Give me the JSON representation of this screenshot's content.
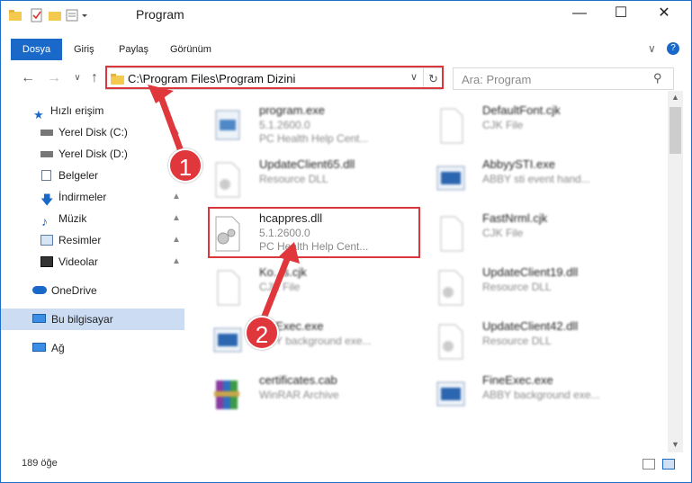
{
  "window": {
    "title": "Program"
  },
  "ribbon": {
    "tabs": [
      "Dosya",
      "Giriş",
      "Paylaş",
      "Görünüm"
    ]
  },
  "address": {
    "path": "C:\\Program Files\\Program Dizini"
  },
  "search": {
    "placeholder": "Ara: Program"
  },
  "sidebar": {
    "items": [
      {
        "label": "Hızlı erişim",
        "icon": "star-icon"
      },
      {
        "label": "Yerel Disk (C:)",
        "icon": "drive-icon",
        "pinned": true
      },
      {
        "label": "Yerel Disk (D:)",
        "icon": "drive-icon",
        "pinned": true
      },
      {
        "label": "Belgeler",
        "icon": "documents-icon",
        "pinned": true
      },
      {
        "label": "İndirmeler",
        "icon": "download-icon",
        "pinned": true
      },
      {
        "label": "Müzik",
        "icon": "music-icon",
        "pinned": true
      },
      {
        "label": "Resimler",
        "icon": "pictures-icon",
        "pinned": true
      },
      {
        "label": "Videolar",
        "icon": "video-icon",
        "pinned": true
      },
      {
        "label": "OneDrive",
        "icon": "cloud-icon"
      },
      {
        "label": "Bu bilgisayar",
        "icon": "computer-icon"
      },
      {
        "label": "Ağ",
        "icon": "network-icon"
      }
    ]
  },
  "files": [
    {
      "name": "program.exe",
      "line2": "5.1.2600.0",
      "line3": "PC Health Help Cent..."
    },
    {
      "name": "DefaultFont.cjk",
      "line2": "CJK File",
      "line3": ""
    },
    {
      "name": "UpdateClient65.dll",
      "line2": "Resource DLL",
      "line3": ""
    },
    {
      "name": "AbbyySTI.exe",
      "line2": "ABBY sti event hand...",
      "line3": ""
    },
    {
      "name": "hcappres.dll",
      "line2": "5.1.2600.0",
      "line3": "PC Health Help Cent..."
    },
    {
      "name": "FastNrml.cjk",
      "line2": "CJK File",
      "line3": ""
    },
    {
      "name": "Ko...s.cjk",
      "line2": "CJK File",
      "line3": ""
    },
    {
      "name": "UpdateClient19.dll",
      "line2": "Resource DLL",
      "line3": ""
    },
    {
      "name": "...eExec.exe",
      "line2": "...BY background exe...",
      "line3": ""
    },
    {
      "name": "UpdateClient42.dll",
      "line2": "Resource DLL",
      "line3": ""
    },
    {
      "name": "certificates.cab",
      "line2": "WinRAR Archive",
      "line3": ""
    },
    {
      "name": "FineExec.exe",
      "line2": "ABBY background exe...",
      "line3": ""
    }
  ],
  "annotations": {
    "step1": "1",
    "step2": "2"
  },
  "status": {
    "count": "189 öğe"
  },
  "colors": {
    "accent": "#1a69c9",
    "highlight": "#d9363e"
  }
}
